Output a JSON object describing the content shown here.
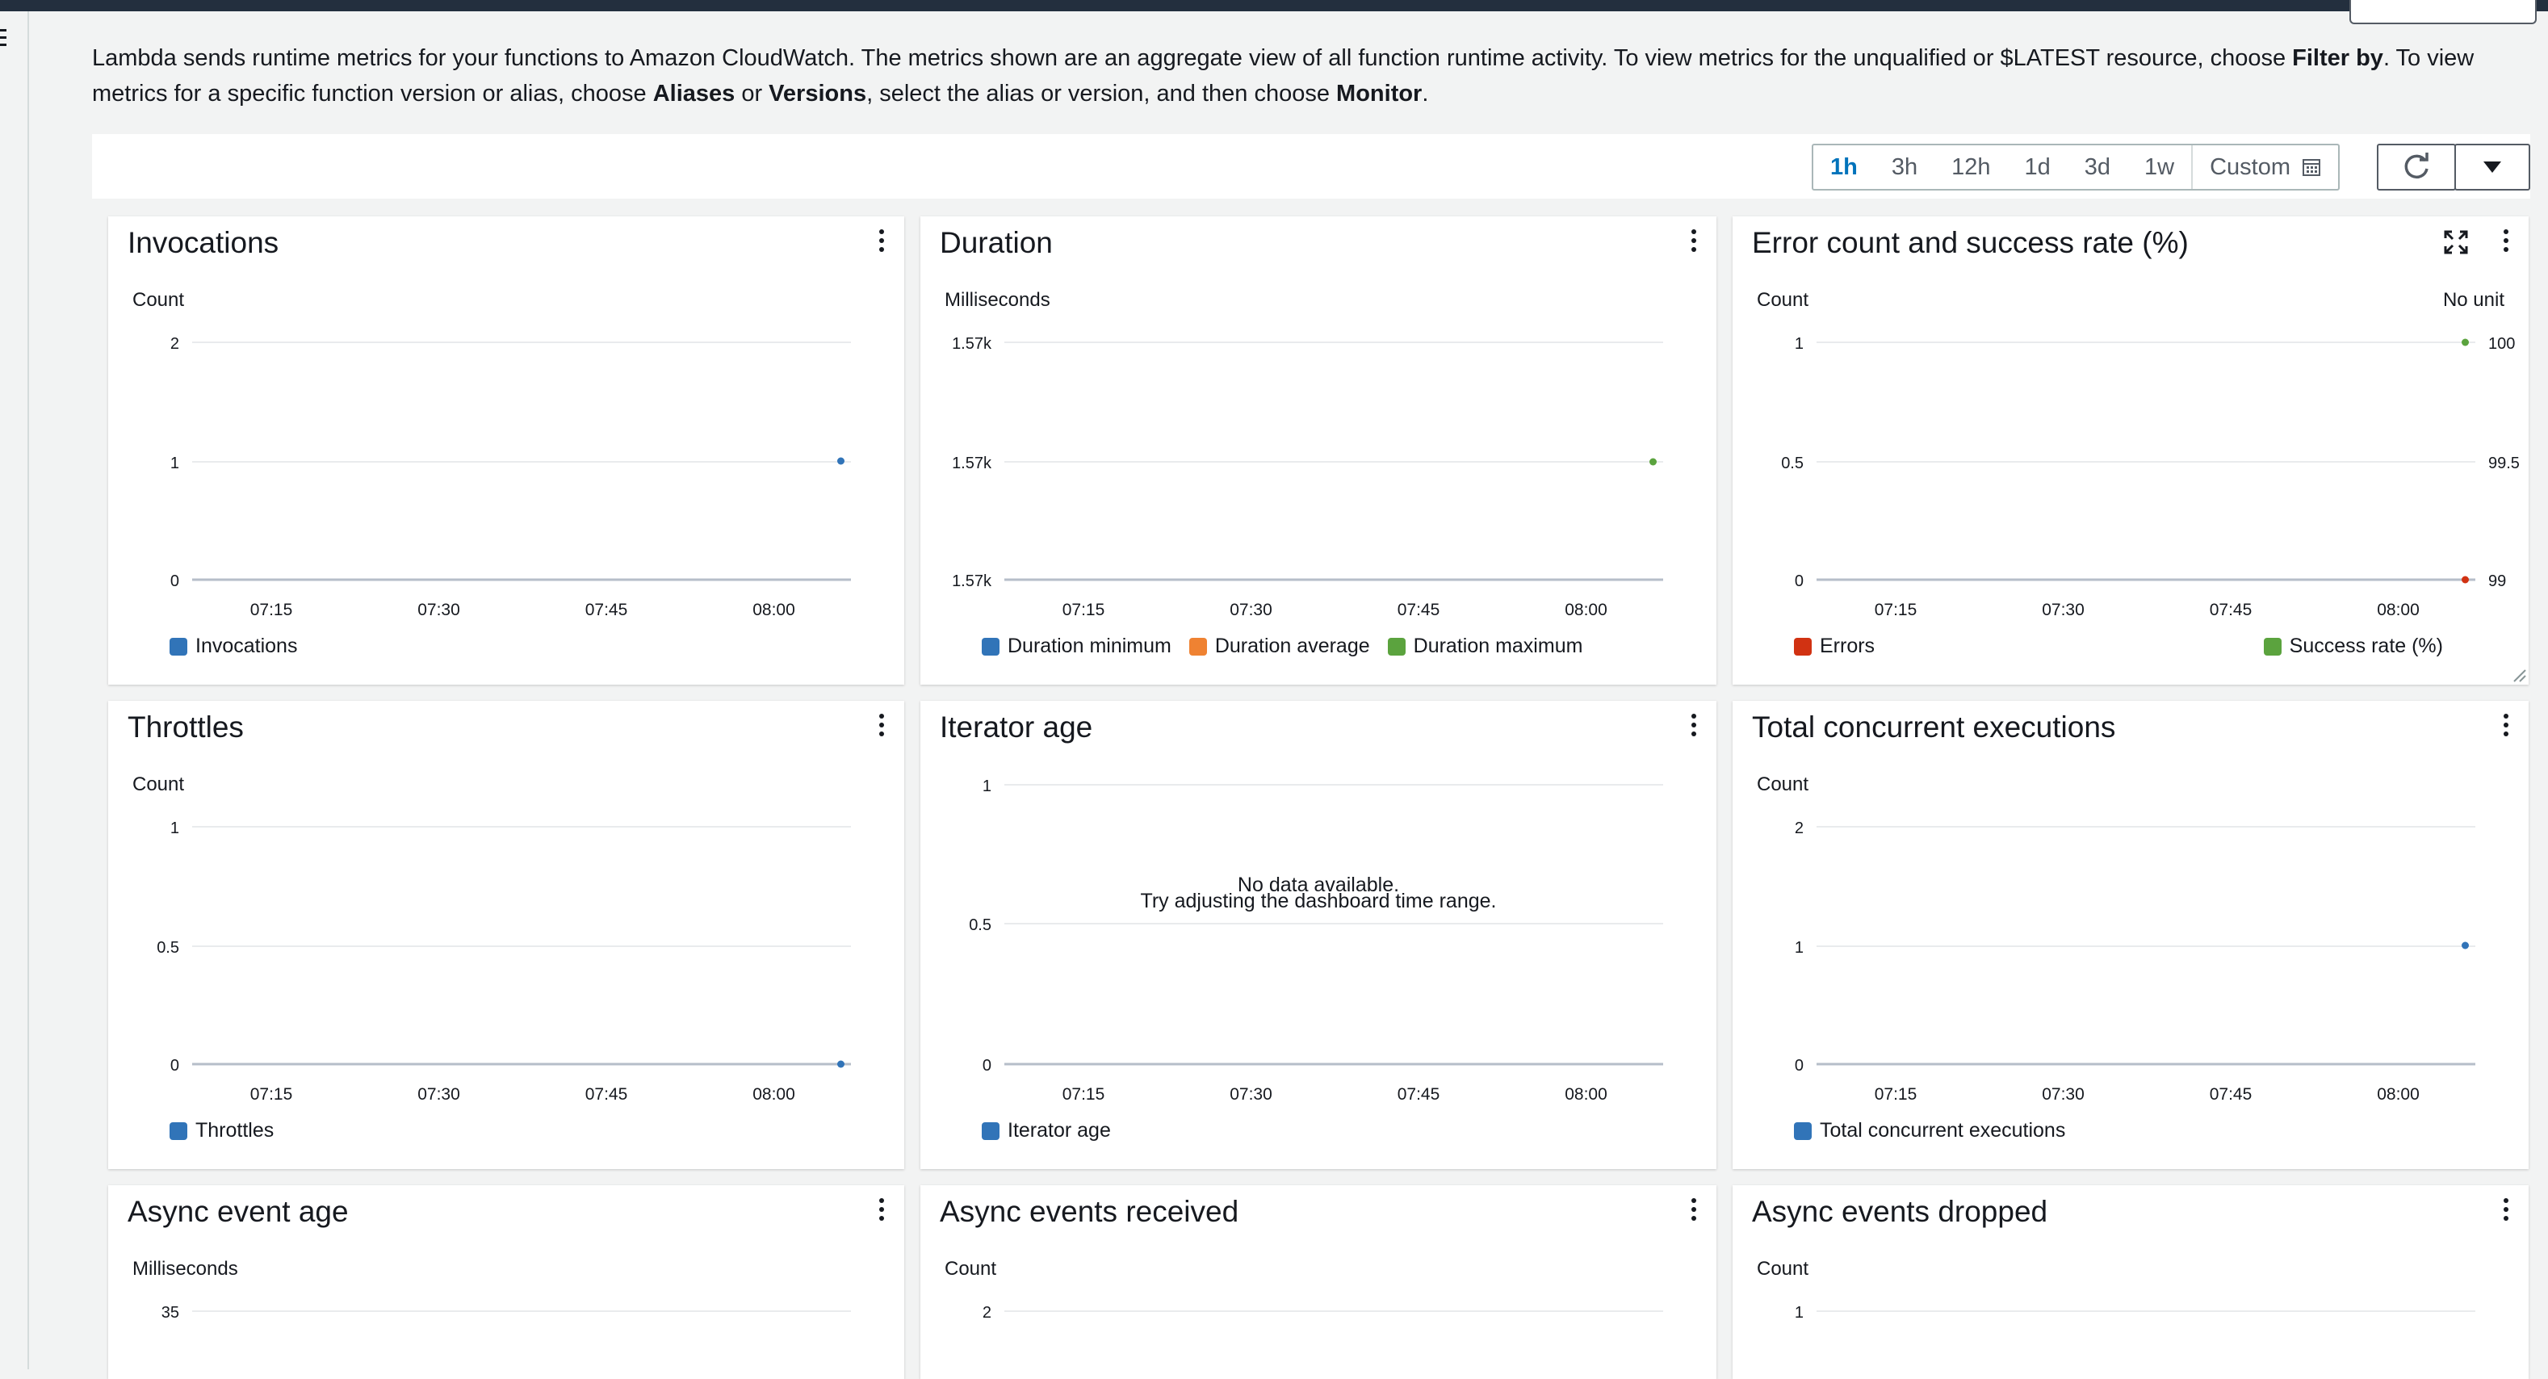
{
  "intro": {
    "p1": "Lambda sends runtime metrics for your functions to Amazon CloudWatch. The metrics shown are an aggregate view of all function runtime activity. To view metrics for the unqualified or $LATEST resource, choose ",
    "b1": "Filter by",
    "p2": ". To view metrics for a specific function version or alias, choose ",
    "b2": "Aliases",
    "p3": " or ",
    "b3": "Versions",
    "p4": ", select the alias or version, and then choose ",
    "b4": "Monitor",
    "p5": "."
  },
  "toolbar": {
    "ranges": [
      "1h",
      "3h",
      "12h",
      "1d",
      "3d",
      "1w"
    ],
    "selected": "1h",
    "custom_label": "Custom",
    "icons": [
      "calendar-icon",
      "refresh-icon",
      "caret-down-icon",
      "menu-icon",
      "kebab-icon",
      "expand-icon",
      "resize-handle-icon"
    ]
  },
  "colors": {
    "blue": "#3174b8",
    "orange": "#ef8232",
    "green": "#5ba33e",
    "red": "#d13212",
    "accent": "#0073bb"
  },
  "panels": [
    {
      "title": "Invocations",
      "chart_data": {
        "type": "line",
        "ylabel": "Count",
        "yticks": [
          "2",
          "1",
          "0"
        ],
        "ylim": [
          0,
          2
        ],
        "xticks": [
          "07:15",
          "07:30",
          "07:45",
          "08:00"
        ],
        "series": [
          {
            "name": "Invocations",
            "color": "#3174b8",
            "points": [
              {
                "x": "08:06",
                "y": 1
              }
            ]
          }
        ]
      }
    },
    {
      "title": "Duration",
      "chart_data": {
        "type": "line",
        "ylabel": "Milliseconds",
        "yticks": [
          "1.57k",
          "1.57k",
          "1.57k"
        ],
        "xticks": [
          "07:15",
          "07:30",
          "07:45",
          "08:00"
        ],
        "series": [
          {
            "name": "Duration minimum",
            "color": "#3174b8",
            "points": []
          },
          {
            "name": "Duration average",
            "color": "#ef8232",
            "points": []
          },
          {
            "name": "Duration maximum",
            "color": "#5ba33e",
            "points": [
              {
                "x": "08:06",
                "y": "1.57k"
              }
            ]
          }
        ]
      }
    },
    {
      "title": "Error count and success rate (%)",
      "chart_data": {
        "type": "line",
        "ylabel": "Count",
        "ylabel_right": "No unit",
        "yticks": [
          "1",
          "0.5",
          "0"
        ],
        "yticks_right": [
          "100",
          "99.5",
          "99"
        ],
        "xticks": [
          "07:15",
          "07:30",
          "07:45",
          "08:00"
        ],
        "series": [
          {
            "name": "Errors",
            "axis": "left",
            "color": "#d13212",
            "points": [
              {
                "x": "08:06",
                "y": 0
              }
            ]
          },
          {
            "name": "Success rate (%)",
            "axis": "right",
            "color": "#5ba33e",
            "points": [
              {
                "x": "08:06",
                "y": 100
              }
            ]
          }
        ]
      }
    },
    {
      "title": "Throttles",
      "chart_data": {
        "type": "line",
        "ylabel": "Count",
        "yticks": [
          "1",
          "0.5",
          "0"
        ],
        "ylim": [
          0,
          1
        ],
        "xticks": [
          "07:15",
          "07:30",
          "07:45",
          "08:00"
        ],
        "series": [
          {
            "name": "Throttles",
            "color": "#3174b8",
            "points": [
              {
                "x": "08:06",
                "y": 0
              }
            ]
          }
        ]
      }
    },
    {
      "title": "Iterator age",
      "chart_data": {
        "type": "line",
        "ylabel": "",
        "yticks": [
          "1",
          "0.5",
          "0"
        ],
        "ylim": [
          0,
          1
        ],
        "xticks": [
          "07:15",
          "07:30",
          "07:45",
          "08:00"
        ],
        "series": [
          {
            "name": "Iterator age",
            "color": "#3174b8",
            "points": []
          }
        ],
        "no_data": [
          "No data available.",
          "Try adjusting the dashboard time range."
        ]
      }
    },
    {
      "title": "Total concurrent executions",
      "chart_data": {
        "type": "line",
        "ylabel": "Count",
        "yticks": [
          "2",
          "1",
          "0"
        ],
        "ylim": [
          0,
          2
        ],
        "xticks": [
          "07:15",
          "07:30",
          "07:45",
          "08:00"
        ],
        "series": [
          {
            "name": "Total concurrent executions",
            "color": "#3174b8",
            "points": [
              {
                "x": "08:06",
                "y": 1
              }
            ]
          }
        ]
      }
    },
    {
      "title": "Async event age",
      "chart_data": {
        "type": "line",
        "ylabel": "Milliseconds",
        "yticks": [
          "35"
        ],
        "xticks": [],
        "series": []
      }
    },
    {
      "title": "Async events received",
      "chart_data": {
        "type": "line",
        "ylabel": "Count",
        "yticks": [
          "2"
        ],
        "xticks": [],
        "series": []
      }
    },
    {
      "title": "Async events dropped",
      "chart_data": {
        "type": "line",
        "ylabel": "Count",
        "yticks": [
          "1"
        ],
        "xticks": [],
        "series": []
      }
    }
  ]
}
